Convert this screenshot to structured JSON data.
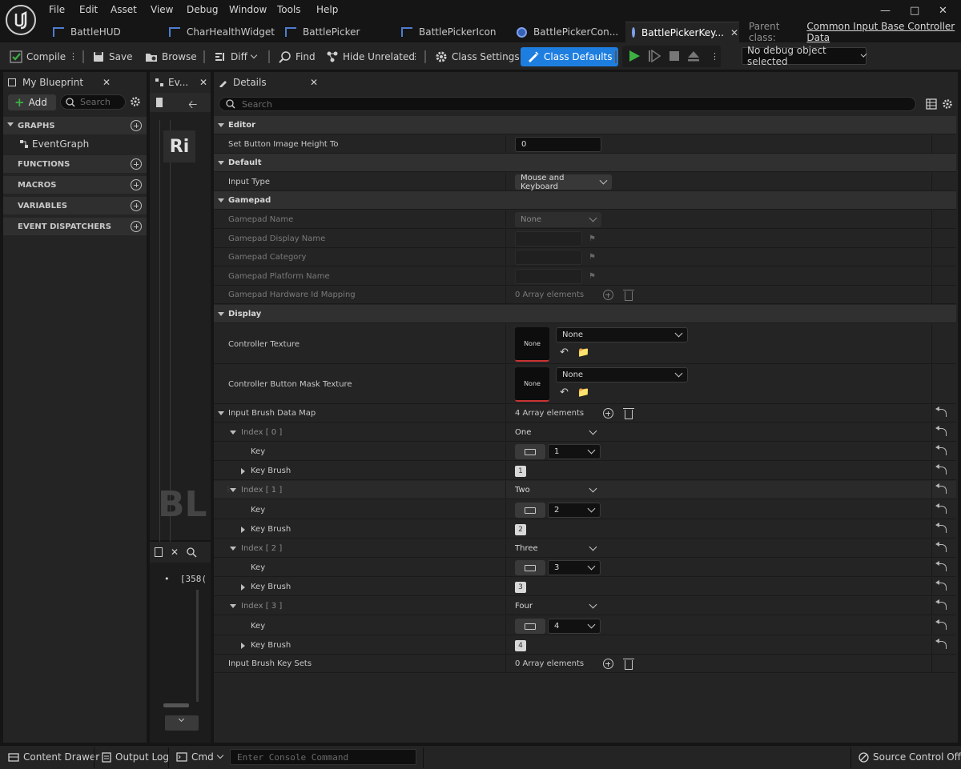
{
  "menu": [
    "File",
    "Edit",
    "Asset",
    "View",
    "Debug",
    "Window",
    "Tools",
    "Help"
  ],
  "doc_tabs": [
    {
      "label": "BattleHUD",
      "icon": "blueprint-icon"
    },
    {
      "label": "CharHealthWidget",
      "icon": "blueprint-icon"
    },
    {
      "label": "BattlePicker",
      "icon": "blueprint-icon"
    },
    {
      "label": "BattlePickerIcon",
      "icon": "blueprint-icon"
    },
    {
      "label": "BattlePickerCon...",
      "icon": "data-asset-icon"
    },
    {
      "label": "BattlePickerKey...",
      "icon": "data-asset-icon",
      "active": true
    }
  ],
  "parent_class": {
    "label": "Parent class:",
    "value": "Common Input Base Controller Data"
  },
  "toolbar": {
    "compile": "Compile",
    "save": "Save",
    "browse": "Browse",
    "diff": "Diff",
    "find": "Find",
    "hide_unrelated": "Hide Unrelated",
    "class_settings": "Class Settings",
    "class_defaults": "Class Defaults",
    "debug_object": "No debug object selected"
  },
  "my_blueprint": {
    "tab": "My Blueprint",
    "add": "Add",
    "search_placeholder": "Search",
    "graphs": "GRAPHS",
    "event_graph": "EventGraph",
    "functions": "FUNCTIONS",
    "macros": "MACROS",
    "variables": "VARIABLES",
    "event_dispatchers": "EVENT DISPATCHERS"
  },
  "event_tab": {
    "label": "Ev..."
  },
  "graph_overlay": {
    "ri": "Ri",
    "bl": "BL",
    "log_item": "[358("
  },
  "details": {
    "tab": "Details",
    "search_placeholder": "Search",
    "editor": "Editor",
    "set_height_label": "Set Button Image Height To",
    "set_height_value": "0",
    "default": "Default",
    "input_type_label": "Input Type",
    "input_type_value": "Mouse and Keyboard",
    "gamepad": "Gamepad",
    "gamepad_name_label": "Gamepad Name",
    "gamepad_name_value": "None",
    "gamepad_display_label": "Gamepad Display Name",
    "gamepad_category_label": "Gamepad Category",
    "gamepad_platform_label": "Gamepad Platform Name",
    "gamepad_hw_label": "Gamepad Hardware Id Mapping",
    "gamepad_hw_value": "0 Array elements",
    "display": "Display",
    "controller_texture_label": "Controller Texture",
    "controller_texture_value": "None",
    "mask_texture_label": "Controller Button Mask Texture",
    "mask_texture_value": "None",
    "thumb_none": "None",
    "brush_map_label": "Input Brush Data Map",
    "brush_map_value": "4 Array elements",
    "entries": [
      {
        "index": "Index [ 0 ]",
        "value": "One",
        "key_label": "Key",
        "key": "1",
        "brush_label": "Key Brush",
        "brush": "1"
      },
      {
        "index": "Index [ 1 ]",
        "value": "Two",
        "key_label": "Key",
        "key": "2",
        "brush_label": "Key Brush",
        "brush": "2"
      },
      {
        "index": "Index [ 2 ]",
        "value": "Three",
        "key_label": "Key",
        "key": "3",
        "brush_label": "Key Brush",
        "brush": "3"
      },
      {
        "index": "Index [ 3 ]",
        "value": "Four",
        "key_label": "Key",
        "key": "4",
        "brush_label": "Key Brush",
        "brush": "4"
      }
    ],
    "key_sets_label": "Input Brush Key Sets",
    "key_sets_value": "0 Array elements"
  },
  "status": {
    "content_drawer": "Content Drawer",
    "output_log": "Output Log",
    "cmd": "Cmd",
    "console_placeholder": "Enter Console Command",
    "source_control": "Source Control Off"
  },
  "colors": {
    "accent": "#1e7ee0",
    "play": "#3cb043",
    "blueprint": "#4f7dd0"
  }
}
